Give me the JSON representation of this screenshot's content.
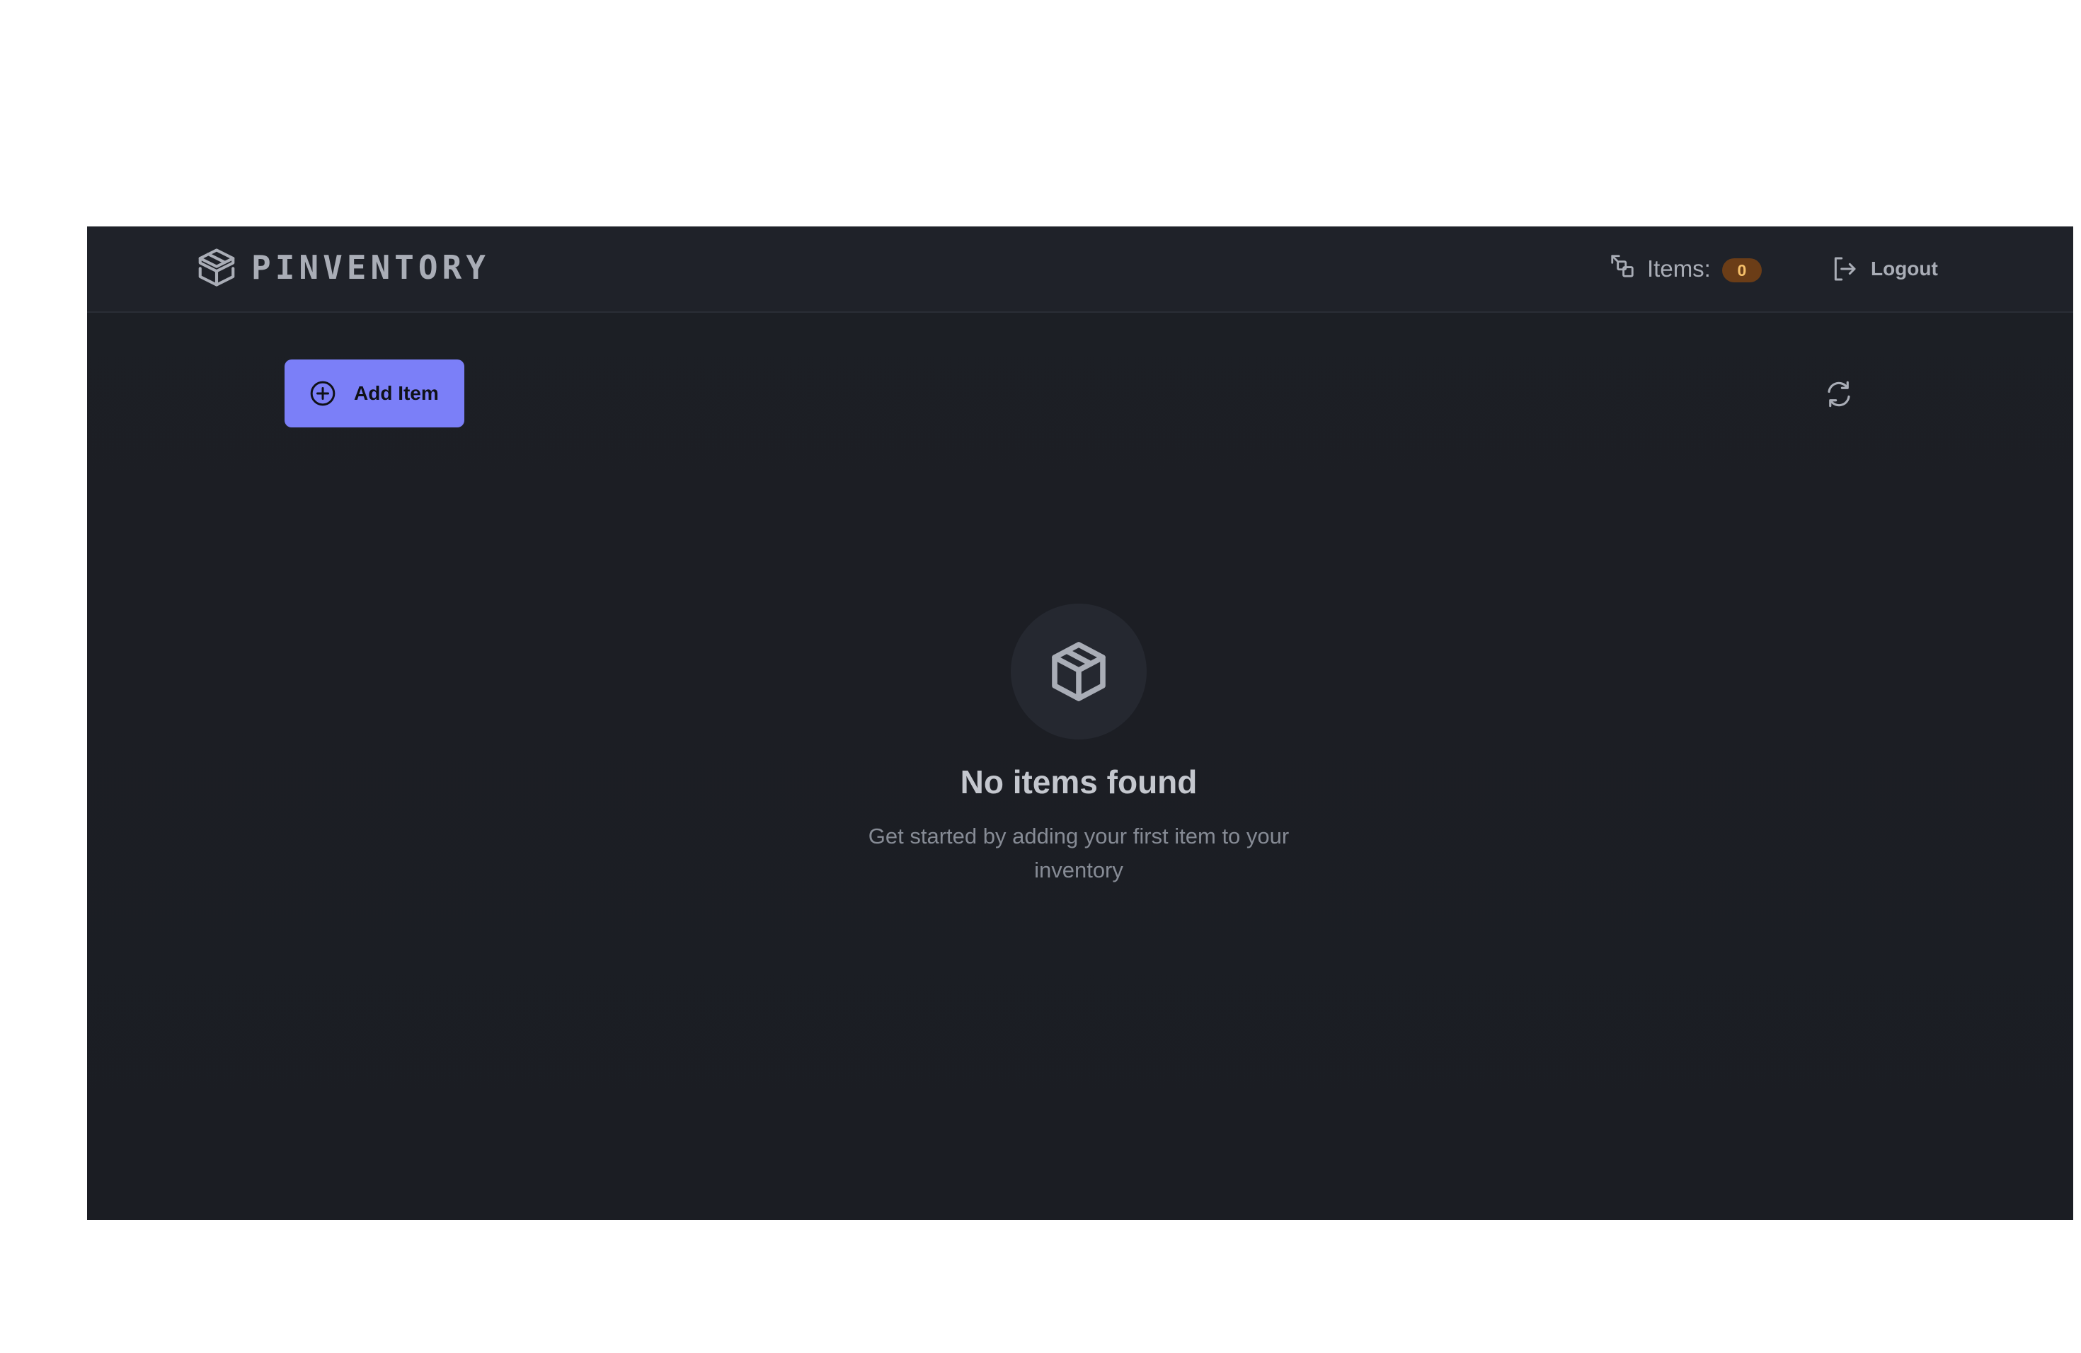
{
  "navbar": {
    "brand_name": "PINVENTORY",
    "brand_icon": "package-stack-icon",
    "items_label": "Items:",
    "items_count": "0",
    "items_icon": "items-swap-icon",
    "logout_label": "Logout",
    "logout_icon": "logout-icon"
  },
  "toolbar": {
    "add_item_label": "Add Item",
    "add_item_icon": "plus-circle-icon",
    "refresh_icon": "refresh-icon"
  },
  "empty_state": {
    "icon": "box-icon",
    "title": "No items found",
    "subtitle": "Get started by adding your first item to your inventory"
  },
  "colors": {
    "background": "#1c1f25",
    "navbar": "#1f2229",
    "accent": "#7b7ff8",
    "badge_bg": "#6b3d17",
    "badge_text": "#f6c06a",
    "text_muted": "#a9adb6"
  }
}
